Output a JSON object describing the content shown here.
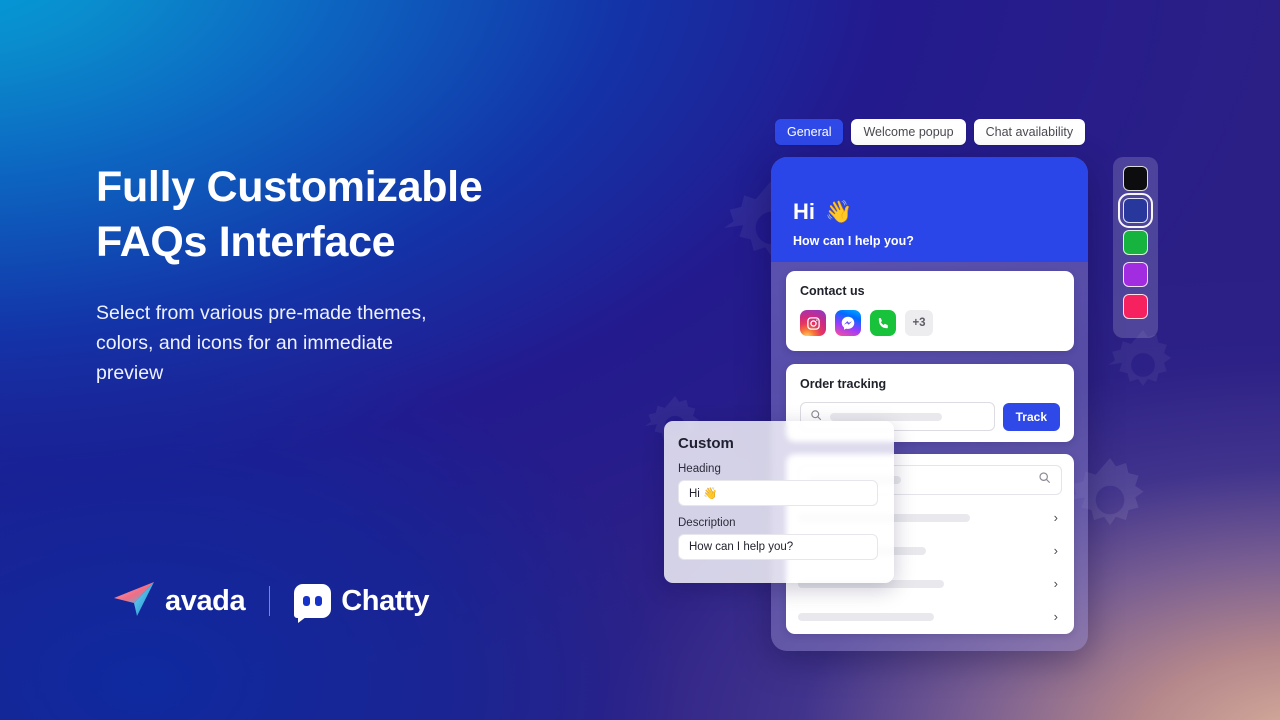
{
  "hero": {
    "headline": "Fully Customizable\nFAQs Interface",
    "subhead": "Select from various pre-made themes,\ncolors, and icons for an immediate\npreview"
  },
  "branding": {
    "avada_name": "avada",
    "chatty_name": "Chatty",
    "avada_logo_icon": "paper-plane-icon",
    "chatty_logo_icon": "chat-bubble-icon"
  },
  "tabs": [
    {
      "label": "General",
      "active": true
    },
    {
      "label": "Welcome popup",
      "active": false
    },
    {
      "label": "Chat availability",
      "active": false
    }
  ],
  "widget": {
    "header": {
      "greeting": "Hi",
      "greeting_emoji": "👋",
      "subtitle": "How can I help you?",
      "background_color": "#2a45e8"
    },
    "contact_card": {
      "title": "Contact us",
      "channels": [
        {
          "name": "instagram-icon",
          "label": "Instagram"
        },
        {
          "name": "messenger-icon",
          "label": "Messenger"
        },
        {
          "name": "phone-icon",
          "label": "Phone"
        }
      ],
      "more_label": "+3"
    },
    "order_card": {
      "title": "Order tracking",
      "search_icon": "search-icon",
      "input_value": "",
      "input_placeholder": "",
      "button_label": "Track"
    },
    "faq_card": {
      "search_icon": "search-icon",
      "search_value": "",
      "rows": [
        {
          "chevron": "›"
        },
        {
          "chevron": "›"
        },
        {
          "chevron": "›"
        },
        {
          "chevron": "›"
        }
      ]
    }
  },
  "custom_panel": {
    "title": "Custom",
    "heading_label": "Heading",
    "heading_value": "Hi 👋",
    "description_label": "Description",
    "description_value": "How can I help you?"
  },
  "swatches": [
    {
      "color": "#0d0d10",
      "name": "black",
      "selected": false
    },
    {
      "color": "#27379b",
      "name": "dark-blue",
      "selected": true
    },
    {
      "color": "#17b33f",
      "name": "green",
      "selected": false
    },
    {
      "color": "#a22cdf",
      "name": "purple",
      "selected": false
    },
    {
      "color": "#f6215f",
      "name": "pink",
      "selected": false
    }
  ],
  "theme": {
    "accent": "#2f49e8",
    "bg_top_left": "#0a8ccd",
    "bg_top_right": "#2b1f86",
    "bg_bottom_left": "#102a9e",
    "bg_bottom_right": "#c2a396"
  }
}
